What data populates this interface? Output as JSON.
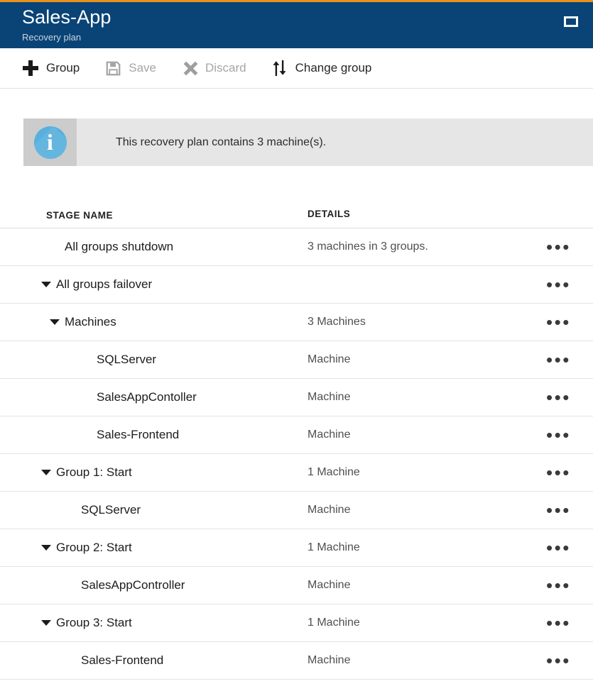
{
  "theme": {
    "accent_top": "#e8921b",
    "header_bg": "#0a4477",
    "info_bg": "#e6e6e6",
    "info_icon_bg": "#cccccc",
    "info_circle": "#57b0dd"
  },
  "titlebar": {
    "title": "Sales-App",
    "subtitle": "Recovery plan",
    "window_button_icon": "maximize-restore-icon"
  },
  "toolbar": {
    "items": [
      {
        "label": "Group",
        "icon": "plus-icon",
        "enabled": true
      },
      {
        "label": "Save",
        "icon": "save-floppy-icon",
        "enabled": false
      },
      {
        "label": "Discard",
        "icon": "close-x-icon",
        "enabled": false
      },
      {
        "label": "Change group",
        "icon": "sort-arrows-icon",
        "enabled": true
      }
    ]
  },
  "info_banner": {
    "icon": "info-circle-icon",
    "message": "This recovery plan contains 3 machine(s)."
  },
  "table": {
    "columns": [
      {
        "key": "stage",
        "label": "STAGE NAME"
      },
      {
        "key": "details",
        "label": "DETAILS"
      }
    ],
    "row_action_icon": "ellipsis-menu-icon",
    "rows": [
      {
        "name": "All groups shutdown",
        "details": "3 machines in 3 groups.",
        "indent": 1,
        "caret": false
      },
      {
        "name": "All groups failover",
        "details": "",
        "indent": 0,
        "caret": true
      },
      {
        "name": "Machines",
        "details": "3 Machines",
        "indent": 1,
        "caret": true
      },
      {
        "name": "SQLServer",
        "details": "Machine",
        "indent": 3,
        "caret": false
      },
      {
        "name": "SalesAppContoller",
        "details": "Machine",
        "indent": 3,
        "caret": false
      },
      {
        "name": "Sales-Frontend",
        "details": "Machine",
        "indent": 3,
        "caret": false
      },
      {
        "name": "Group 1: Start",
        "details": "1 Machine",
        "indent": 0,
        "caret": true
      },
      {
        "name": "SQLServer",
        "details": "Machine",
        "indent": 2,
        "caret": false
      },
      {
        "name": "Group 2: Start",
        "details": "1 Machine",
        "indent": 0,
        "caret": true
      },
      {
        "name": "SalesAppController",
        "details": "Machine",
        "indent": 2,
        "caret": false
      },
      {
        "name": "Group 3: Start",
        "details": "1 Machine",
        "indent": 0,
        "caret": true
      },
      {
        "name": "Sales-Frontend",
        "details": "Machine",
        "indent": 2,
        "caret": false
      }
    ]
  }
}
